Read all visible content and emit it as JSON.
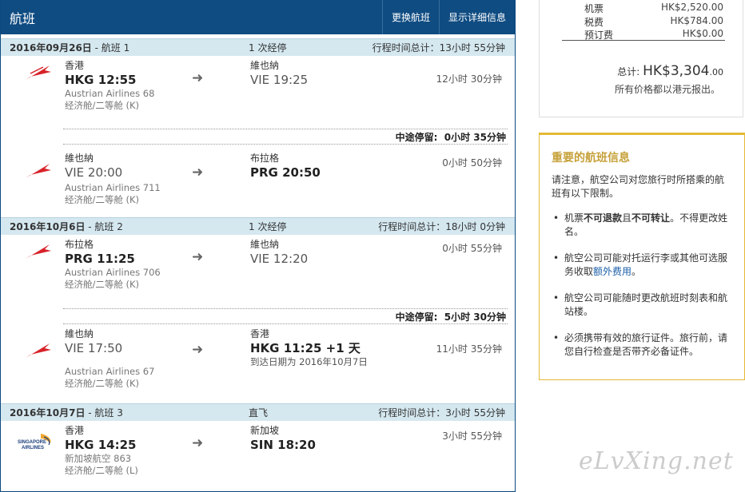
{
  "header": {
    "title": "航班",
    "change_btn": "更换航班",
    "details_btn": "显示详细信息"
  },
  "legs": [
    {
      "date": "2016年09月26日",
      "label": "航班 1",
      "stops": "1 次经停",
      "total": "行程时间总计：13小时 55分钟",
      "segments": [
        {
          "from_city": "香港",
          "from_time": "HKG 12:55",
          "to_city": "維也納",
          "to_time": "VIE 19:25",
          "airline": "Austrian Airlines 68",
          "cabin": "经济舱/二等舱 (K)",
          "duration": "12小时 30分钟",
          "note": ""
        },
        {
          "from_city": "維也納",
          "from_time": "VIE 20:00",
          "to_city": "布拉格",
          "to_time": "PRG 20:50",
          "airline": "Austrian Airlines 711",
          "cabin": "经济舱/二等舱 (K)",
          "duration": "0小时 50分钟",
          "note": ""
        }
      ],
      "layover_label": "中途停留:",
      "layover_time": "0小时 35分钟"
    },
    {
      "date": "2016年10月6日",
      "label": "航班 2",
      "stops": "1 次经停",
      "total": "行程时间总计：18小时 0分钟",
      "segments": [
        {
          "from_city": "布拉格",
          "from_time": "PRG 11:25",
          "to_city": "維也納",
          "to_time": "VIE 12:20",
          "airline": "Austrian Airlines 706",
          "cabin": "经济舱/二等舱 (K)",
          "duration": "0小时 55分钟",
          "note": ""
        },
        {
          "from_city": "維也納",
          "from_time": "VIE 17:50",
          "to_city": "香港",
          "to_time": "HKG 11:25 +1 天",
          "airline": "Austrian Airlines 67",
          "cabin": "经济舱/二等舱 (K)",
          "duration": "11小时 35分钟",
          "note": "到达日期为 2016年10月7日"
        }
      ],
      "layover_label": "中途停留:",
      "layover_time": "5小时 30分钟"
    },
    {
      "date": "2016年10月7日",
      "label": "航班 3",
      "stops": "直飞",
      "total": "行程时间总计：3小时 55分钟",
      "segments": [
        {
          "from_city": "香港",
          "from_time": "HKG 14:25",
          "to_city": "新加坡",
          "to_time": "SIN 18:20",
          "airline": "新加坡航空 863",
          "cabin": "经济舱/二等舱 (L)",
          "duration": "3小时 55分钟",
          "note": ""
        }
      ]
    }
  ],
  "price": {
    "rows": [
      {
        "label": "机票",
        "value": "HK$2,520.00"
      },
      {
        "label": "税费",
        "value": "HK$784.00"
      },
      {
        "label": "预订费",
        "value": "HK$0.00"
      }
    ],
    "total_label": "总计:",
    "total_main": "HK$3,304",
    "total_cents": ".00",
    "note": "所有价格都以港元报出。"
  },
  "important": {
    "title": "重要的航班信息",
    "intro": "请注意，航空公司对您旅行时所搭乘的航班有以下限制。",
    "items": [
      {
        "pre": "机票",
        "b1": "不可退款",
        "mid": "且",
        "b2": "不可转让",
        "post": "。不得更改姓名。"
      },
      {
        "pre": "航空公司可能对托运行李或其他可选服务收取",
        "link": "额外费用",
        "post": "。"
      },
      {
        "text": "航空公司可能随时更改航班时刻表和航站楼。"
      },
      {
        "text": "必须携带有效的旅行证件。旅行前，请您自行检查是否带齐必备证件。"
      }
    ]
  },
  "watermark": "eLvXing.net",
  "colors": {
    "header_bg": "#0f4c82",
    "leg_bar": "#d5e8f0",
    "accent_gold": "#c6a13a"
  }
}
